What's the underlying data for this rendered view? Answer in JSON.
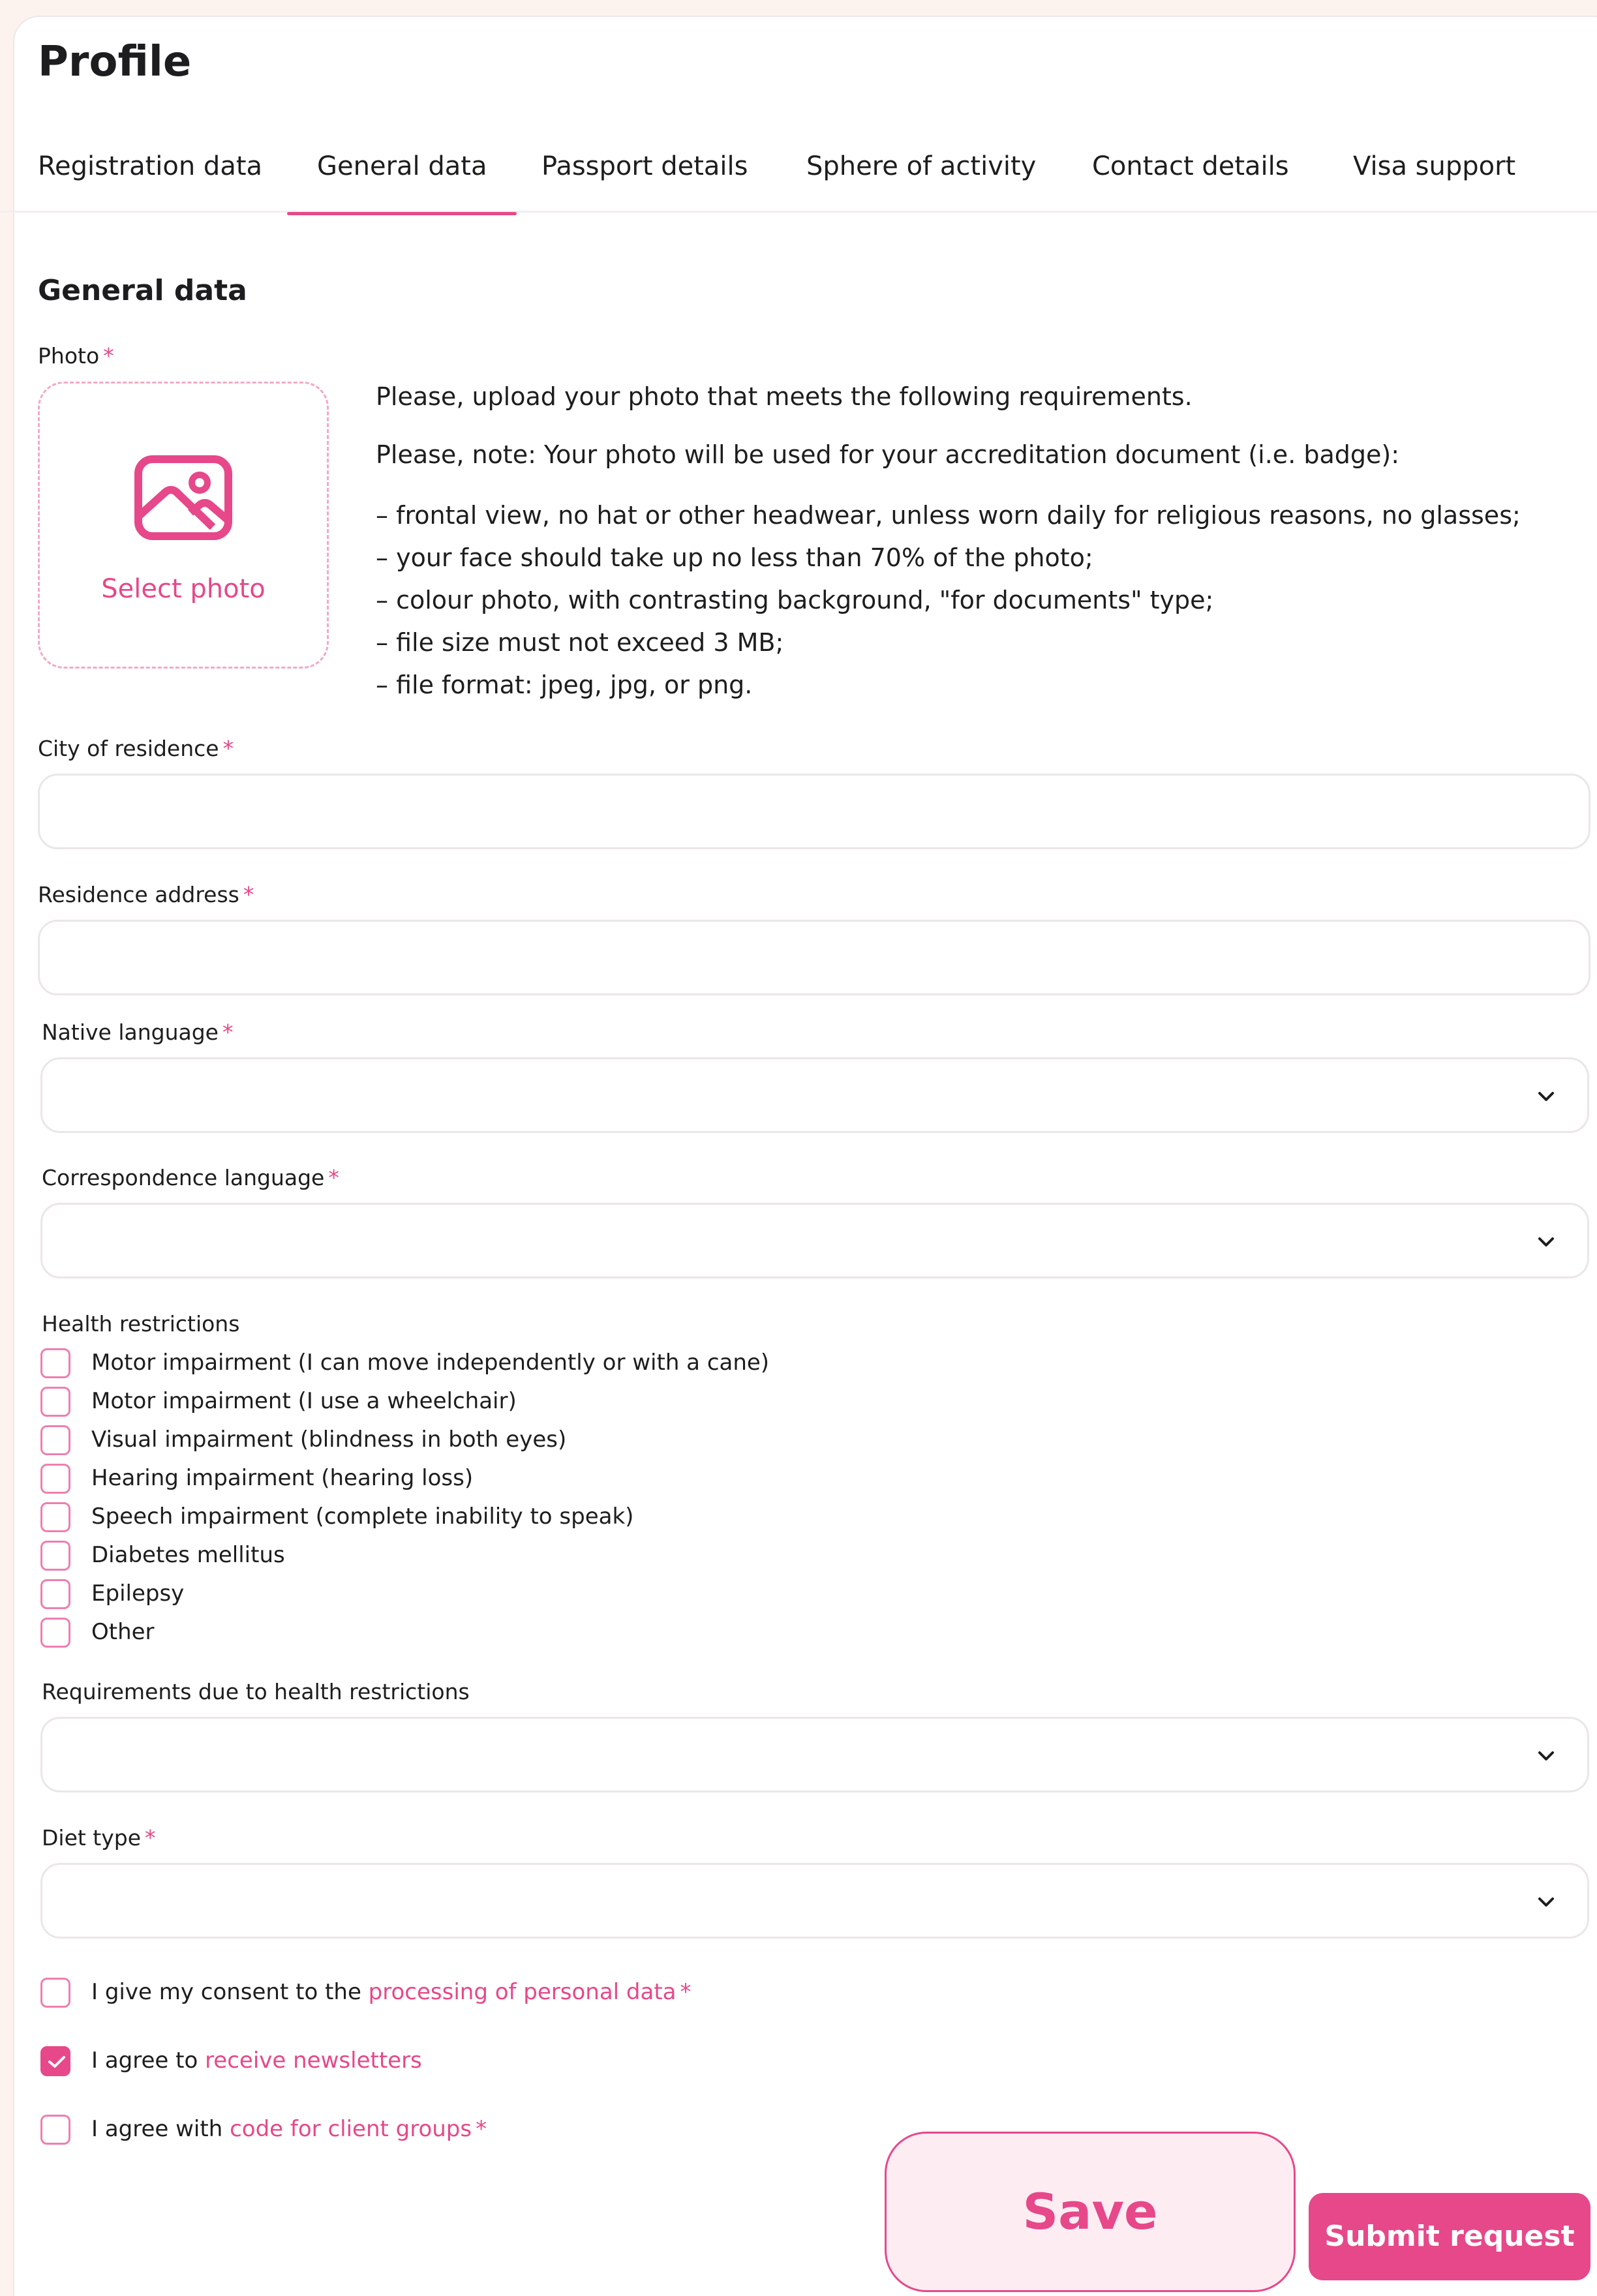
{
  "page": {
    "title": "Profile",
    "section_title": "General data"
  },
  "tabs": [
    {
      "label": "Registration data"
    },
    {
      "label": "General data"
    },
    {
      "label": "Passport details"
    },
    {
      "label": "Sphere of activity"
    },
    {
      "label": "Contact details"
    },
    {
      "label": "Visa support"
    }
  ],
  "active_tab": "General data",
  "photo": {
    "label": "Photo",
    "required_mark": "*",
    "button_label": "Select photo",
    "icon": "image-icon",
    "requirements": [
      "Please, upload your photo that meets the following requirements.",
      "Please, note: Your photo will be used for your accreditation document (i.e. badge):",
      "– frontal view, no hat or other headwear, unless worn daily for religious reasons, no glasses;",
      "– your face should take up no less than 70% of the photo;",
      "– colour photo, with contrasting background, \"for documents\" type;",
      "– file size must not exceed 3 MB;",
      "– file format: jpeg, jpg, or png."
    ]
  },
  "fields": {
    "city": {
      "label": "City of residence",
      "value": ""
    },
    "address": {
      "label": "Residence address",
      "value": ""
    },
    "native_language": {
      "label": "Native language",
      "value": ""
    },
    "correspondence_language": {
      "label": "Correspondence language",
      "value": ""
    },
    "health_requirements": {
      "label": "Requirements due to health restrictions",
      "value": ""
    },
    "diet_type": {
      "label": "Diet type",
      "value": ""
    }
  },
  "health": {
    "label": "Health restrictions",
    "options": [
      {
        "label": "Motor impairment (I can move independently or with a cane)",
        "checked": false
      },
      {
        "label": "Motor impairment (I use a wheelchair)",
        "checked": false
      },
      {
        "label": "Visual impairment (blindness in both eyes)",
        "checked": false
      },
      {
        "label": "Hearing impairment (hearing loss)",
        "checked": false
      },
      {
        "label": "Speech impairment (complete inability to speak)",
        "checked": false
      },
      {
        "label": "Diabetes mellitus",
        "checked": false
      },
      {
        "label": "Epilepsy",
        "checked": false
      },
      {
        "label": "Other",
        "checked": false
      }
    ]
  },
  "consents": [
    {
      "prefix": "I give my consent to the ",
      "link": "processing of personal data",
      "required": "*",
      "checked": false
    },
    {
      "prefix": "I agree to ",
      "link": "receive newsletters",
      "required": "",
      "checked": true
    },
    {
      "prefix": "I agree with ",
      "link": "code for client groups",
      "required": "*",
      "checked": false
    }
  ],
  "actions": {
    "save": "Save",
    "submit": "Submit request"
  },
  "colors": {
    "accent": "#e6488a",
    "background": "#fdf3ee",
    "border": "#ebe6e8"
  }
}
